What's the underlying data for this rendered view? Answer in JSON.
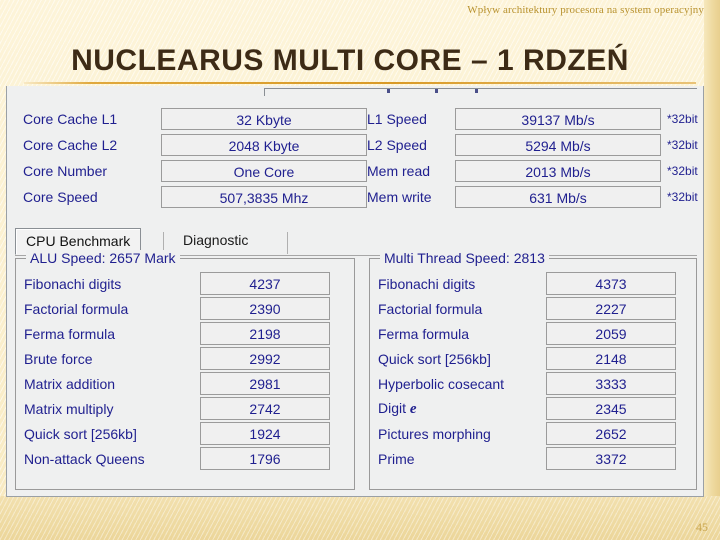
{
  "slide": {
    "kicker": "Wpływ architektury procesora na system operacyjny",
    "title": "NUCLEARUS MULTI CORE – 1 RDZEŃ",
    "number": "45",
    "accent_color": "#d99a26",
    "background_color": "#fbf0cf",
    "title_color": "#3d2b16"
  },
  "app": {
    "ui_text_color": "#1f1f8f",
    "cpu_info": {
      "left_rows": [
        {
          "label": "Core Cache L1",
          "value": "32 Kbyte"
        },
        {
          "label": "Core Cache L2",
          "value": "2048 Kbyte"
        },
        {
          "label": "Core Number",
          "value": "One Core"
        },
        {
          "label": "Core Speed",
          "value": "507,3835 Mhz"
        }
      ],
      "right_rows": [
        {
          "label": "L1 Speed",
          "value": "39137 Mb/s",
          "suffix": "*32bit"
        },
        {
          "label": "L2 Speed",
          "value": "5294 Mb/s",
          "suffix": "*32bit"
        },
        {
          "label": "Mem read",
          "value": "2013 Mb/s",
          "suffix": "*32bit"
        },
        {
          "label": "Mem write",
          "value": "631 Mb/s",
          "suffix": "*32bit"
        }
      ]
    },
    "tabs": [
      {
        "label": "CPU Benchmark",
        "selected": true
      },
      {
        "label": "Diagnostic",
        "selected": false
      }
    ],
    "benchmark_left": {
      "legend": "ALU Speed: 2657 Mark",
      "rows": [
        {
          "label": "Fibonachi digits",
          "value": "4237"
        },
        {
          "label": "Factorial formula",
          "value": "2390"
        },
        {
          "label": "Ferma formula",
          "value": "2198"
        },
        {
          "label": "Brute force",
          "value": "2992"
        },
        {
          "label": "Matrix addition",
          "value": "2981"
        },
        {
          "label": "Matrix multiply",
          "value": "2742"
        },
        {
          "label": "Quick sort [256kb]",
          "value": "1924"
        },
        {
          "label": "Non-attack Queens",
          "value": "1796"
        }
      ]
    },
    "benchmark_right": {
      "legend": "Multi Thread Speed: 2813",
      "rows": [
        {
          "label": "Fibonachi digits",
          "value": "4373"
        },
        {
          "label": "Factorial formula",
          "value": "2227"
        },
        {
          "label": "Ferma formula",
          "value": "2059"
        },
        {
          "label": "Quick sort [256kb]",
          "value": "2148"
        },
        {
          "label": "Hyperbolic cosecant",
          "value": "3333"
        },
        {
          "label": "Digit ",
          "value": "2345",
          "suffix_glyph": "e"
        },
        {
          "label": "Pictures morphing",
          "value": "2652"
        },
        {
          "label": "Prime",
          "value": "3372"
        }
      ]
    }
  }
}
